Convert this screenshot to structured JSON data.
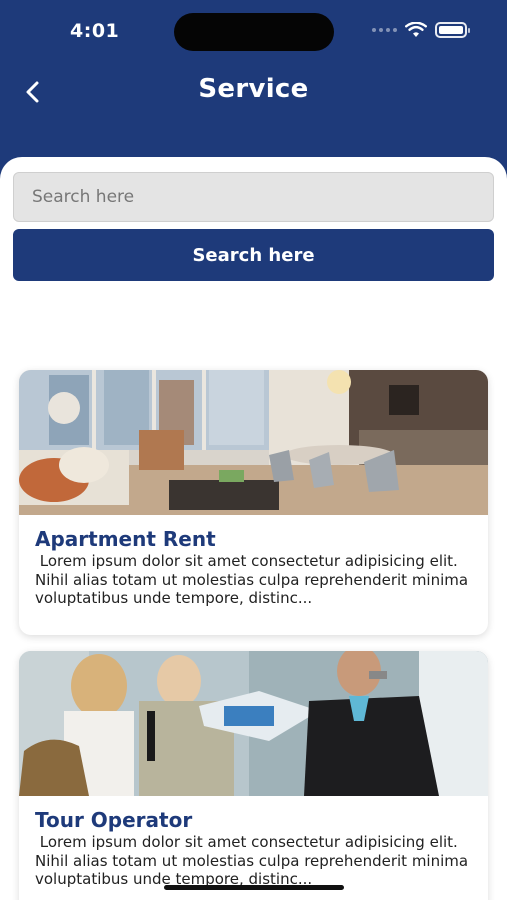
{
  "status_bar": {
    "time": "4:01"
  },
  "header": {
    "title": "Service"
  },
  "search": {
    "placeholder": "Search here",
    "value": "",
    "button_label": "Search here"
  },
  "services": [
    {
      "title": "Apartment Rent",
      "description": " Lorem ipsum dolor sit amet consectetur adipisicing elit. Nihil alias totam ut molestias culpa reprehenderit minima voluptatibus unde tempore, distinc..."
    },
    {
      "title": "Tour Operator",
      "description": " Lorem ipsum dolor sit amet consectetur adipisicing elit. Nihil alias totam ut molestias culpa reprehenderit minima voluptatibus unde tempore, distinc..."
    }
  ],
  "colors": {
    "primary": "#1e3a7a",
    "background": "#ffffff",
    "input_bg": "#e4e4e4"
  }
}
